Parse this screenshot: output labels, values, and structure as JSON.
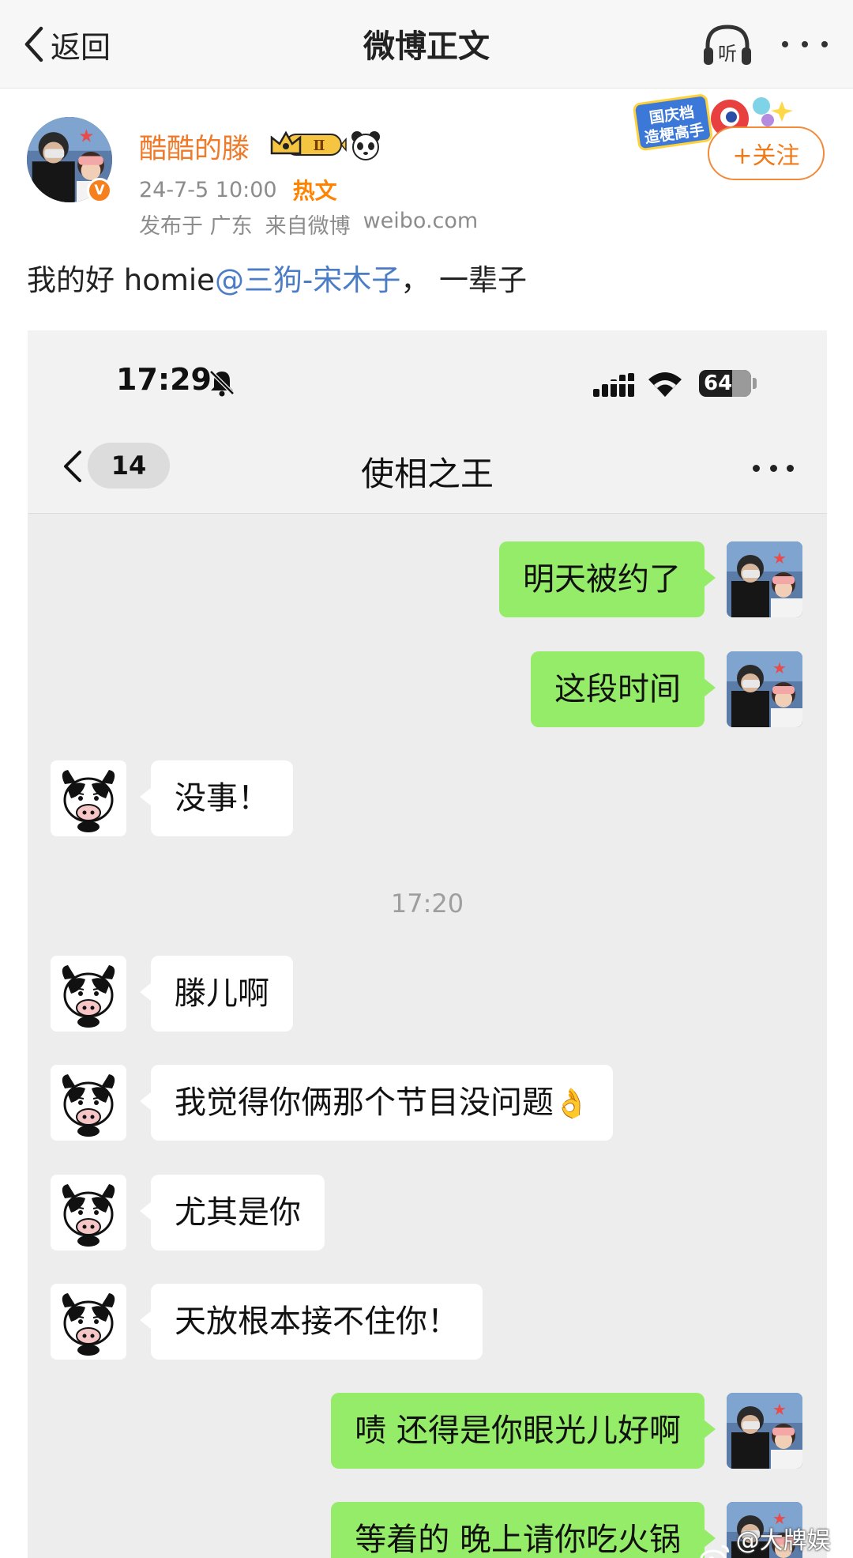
{
  "header": {
    "back_label": "返回",
    "title": "微博正文",
    "listen_label": "听"
  },
  "post": {
    "username": "酷酷的滕",
    "level_badge": "Ⅱ",
    "timestamp": "24-7-5 10:00",
    "hot_tag": "热文",
    "published_from": "发布于 广东",
    "source": "来自微博",
    "source_domain": "weibo.com",
    "promo_sticker": "国庆档造梗高手",
    "follow_label": "+关注",
    "text_before": "我的好 homie",
    "mention": "@三狗-宋木子",
    "text_after": "， 一辈子"
  },
  "chat": {
    "status_time": "17:29",
    "battery": "64",
    "unread_count": "14",
    "title": "使相之王",
    "divider_time": "17:20",
    "messages": [
      {
        "side": "me",
        "text": "明天被约了"
      },
      {
        "side": "me",
        "text": "这段时间"
      },
      {
        "side": "them",
        "text": "没事！"
      },
      {
        "side": "them",
        "text": "滕儿啊"
      },
      {
        "side": "them",
        "text": "我觉得你俩那个节目没问题",
        "emoji": "👌"
      },
      {
        "side": "them",
        "text": "尤其是你"
      },
      {
        "side": "them",
        "text": "天放根本接不住你！"
      },
      {
        "side": "me",
        "text": "啧 还得是你眼光儿好啊"
      },
      {
        "side": "me",
        "text": "等着的 晚上请你吃火锅"
      }
    ]
  },
  "watermark": {
    "text": "@大牌娱乐"
  },
  "colors": {
    "username": "#ee7a2a",
    "mention": "#4b7cc6",
    "bubble_me": "#95ec69",
    "bubble_them": "#ffffff",
    "chat_bg": "#ededed"
  },
  "icons": [
    "chevron-left-icon",
    "headphones-icon",
    "more-icon",
    "verified-icon",
    "crown-icon",
    "panda-icon",
    "bell-off-icon",
    "signal-icon",
    "wifi-icon",
    "battery-icon",
    "ok-hand-icon",
    "weibo-logo-icon"
  ]
}
